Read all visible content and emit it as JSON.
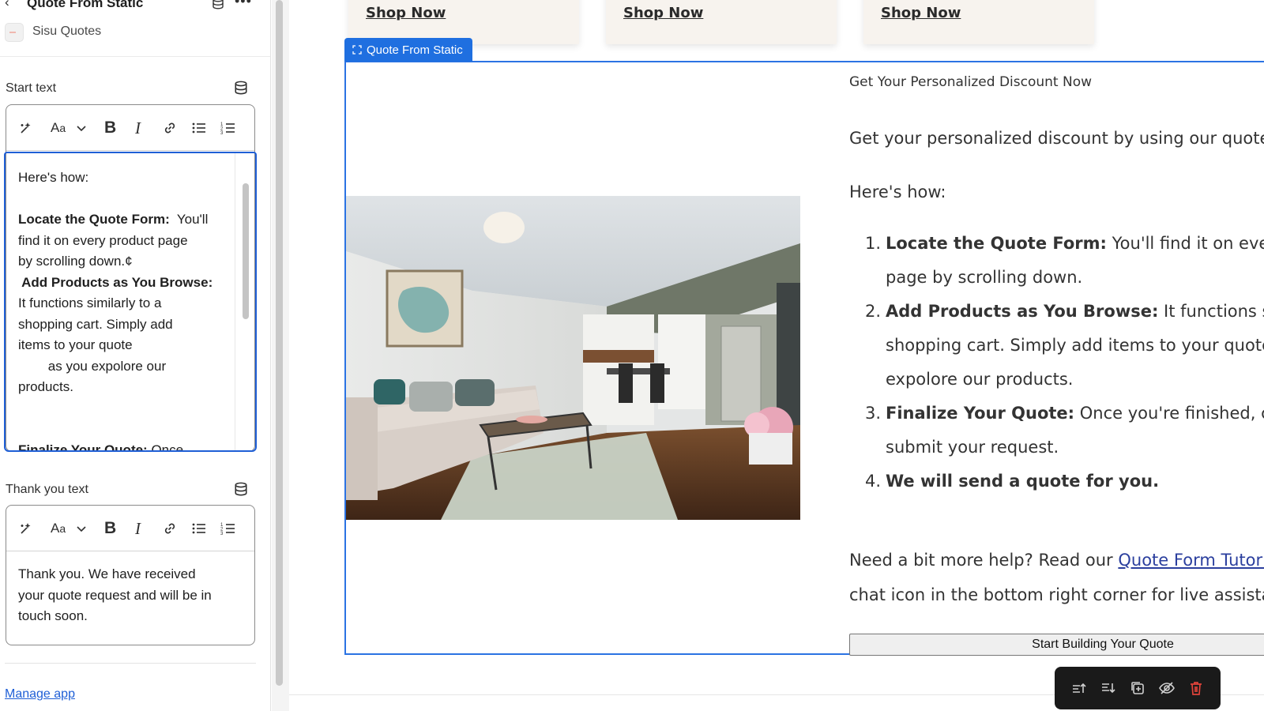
{
  "sidebar": {
    "title": "Quote From Static",
    "app_name": "Sisu Quotes",
    "start_text": {
      "label": "Start text",
      "lines": [
        {
          "text": "Here's how:",
          "bold": ""
        },
        {
          "text": "",
          "bold": ""
        },
        {
          "bold": "Locate the Quote Form:",
          "text": "  You'll"
        },
        {
          "bold": "",
          "text": "find it on every product page"
        },
        {
          "bold": "",
          "text": "by scrolling down.¢"
        },
        {
          "bold": " Add Products as You Browse:",
          "text": ""
        },
        {
          "bold": "",
          "text": "It functions similarly to a"
        },
        {
          "bold": "",
          "text": "shopping cart. Simply add"
        },
        {
          "bold": "",
          "text": "items to your quote"
        },
        {
          "bold": "",
          "text": "        as you expolore our"
        },
        {
          "bold": "",
          "text": "products."
        },
        {
          "bold": "",
          "text": ""
        },
        {
          "bold": "",
          "text": ""
        },
        {
          "bold": "Finalize Your Quote:",
          "text": " Once"
        }
      ]
    },
    "thank_you_text": {
      "label": "Thank you text",
      "lines": [
        "Thank you. We have received",
        "your quote request and will be in",
        "touch soon."
      ]
    },
    "manage_link": "Manage app",
    "toolbar_icons": [
      "sparkle-icon",
      "font-size-icon",
      "chevron-down-icon",
      "bold-icon",
      "italic-icon",
      "link-icon",
      "bullet-list-icon",
      "numbered-list-icon"
    ]
  },
  "canvas": {
    "cards": [
      {
        "label": "Shop Now"
      },
      {
        "label": "Shop Now"
      },
      {
        "label": "Shop Now"
      }
    ],
    "section_tag": "Quote From Static",
    "discount_title": "Get Your Personalized Discount Now",
    "intro": "Get your personalized discount by using our quote fo",
    "heres_how": "Here's how:",
    "steps": [
      {
        "num": "1.",
        "bold": "Locate the Quote Form:",
        "text": " You'll find it on every p"
      },
      {
        "num": "",
        "bold": "",
        "text": "page by scrolling down."
      },
      {
        "num": "2.",
        "bold": "Add Products as You Browse:",
        "text": " It functions simila"
      },
      {
        "num": "",
        "bold": "",
        "text": "shopping cart. Simply add items to your quote a"
      },
      {
        "num": "",
        "bold": "",
        "text": "expolore our products."
      },
      {
        "num": "3.",
        "bold": "Finalize Your Quote:",
        "text": " Once you're finished, click"
      },
      {
        "num": "",
        "bold": "",
        "text": "submit your request."
      },
      {
        "num": "4.",
        "bold": "We will send a quote for you.",
        "text": ""
      }
    ],
    "help_prefix": "Need a bit more help? Read our ",
    "help_link": "Quote Form Tutorial",
    "help_line2": "chat icon in the bottom right corner for live assistanc",
    "start_button": "Start Building Your Quote",
    "float_actions": [
      "move-up-icon",
      "move-down-icon",
      "duplicate-icon",
      "hide-icon",
      "delete-icon"
    ]
  },
  "colors": {
    "accent": "#1f6fe0",
    "card_bg": "#f7f3ee",
    "link": "#2b3f9e",
    "delete": "#e0433a"
  }
}
